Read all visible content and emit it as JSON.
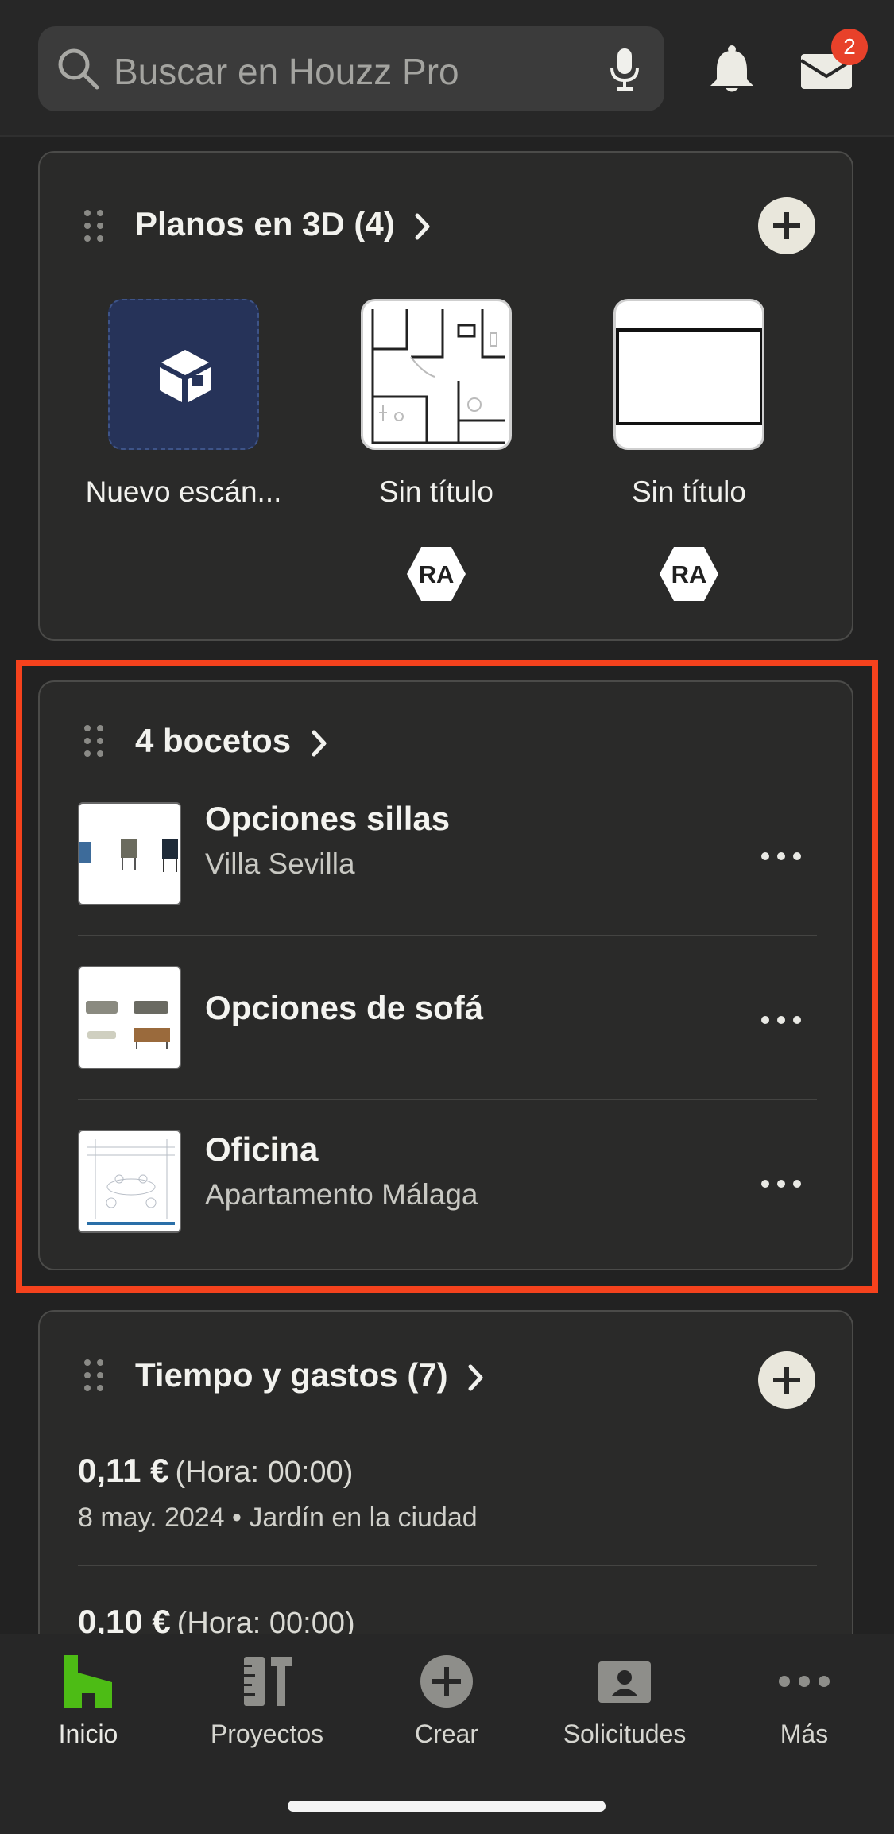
{
  "search": {
    "placeholder": "Buscar en Houzz Pro"
  },
  "header": {
    "mail_badge": "2"
  },
  "plans": {
    "title": "Planos en 3D (4)",
    "items": [
      {
        "label": "Nuevo escán..."
      },
      {
        "label": "Sin título",
        "badge": "RA"
      },
      {
        "label": "Sin título",
        "badge": "RA"
      }
    ]
  },
  "sketches": {
    "title": "4 bocetos",
    "items": [
      {
        "title": "Opciones sillas",
        "subtitle": "Villa Sevilla"
      },
      {
        "title": "Opciones de sofá",
        "subtitle": ""
      },
      {
        "title": "Oficina",
        "subtitle": "Apartamento Málaga"
      }
    ]
  },
  "expenses": {
    "title": "Tiempo y gastos (7)",
    "items": [
      {
        "amount": "0,11 €",
        "hours": "(Hora: 00:00)",
        "detail": "8 may. 2024 • Jardín en la ciudad"
      },
      {
        "amount": "0,10 €",
        "hours": "(Hora: 00:00)",
        "detail": ""
      }
    ]
  },
  "tabbar": {
    "tabs": [
      {
        "label": "Inicio",
        "icon": "houzz-home-icon"
      },
      {
        "label": "Proyectos",
        "icon": "projects-icon"
      },
      {
        "label": "Crear",
        "icon": "create-plus-icon"
      },
      {
        "label": "Solicitudes",
        "icon": "requests-icon"
      },
      {
        "label": "Más",
        "icon": "more-icon"
      }
    ]
  },
  "colors": {
    "accent_green": "#4dbc15",
    "highlight_red": "#f5421d",
    "badge_red": "#e8412a",
    "scan_tile": "#263359"
  }
}
